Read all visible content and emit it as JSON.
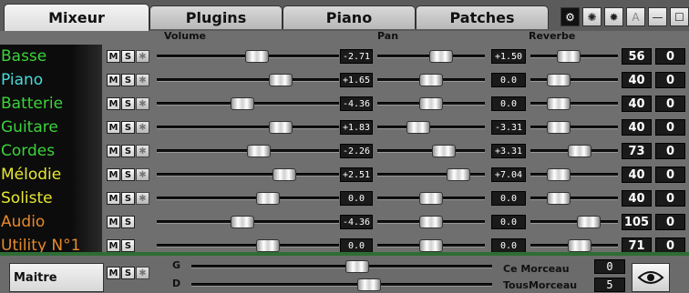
{
  "tabs": [
    {
      "label": "Mixeur",
      "active": true
    },
    {
      "label": "Plugins",
      "active": false
    },
    {
      "label": "Piano",
      "active": false
    },
    {
      "label": "Patches",
      "active": false
    }
  ],
  "toolbar": {
    "icons": [
      "gear-icon",
      "burst-icon",
      "burst-icon",
      "font-a-icon",
      "minimize-icon",
      "maximize-icon"
    ],
    "a_label": "A",
    "minus_label": "—"
  },
  "headers": {
    "volume": "Volume",
    "pan": "Pan",
    "reverb": "Reverbe"
  },
  "buttons": {
    "mute": "M",
    "solo": "S"
  },
  "tracks": [
    {
      "name": "Basse",
      "color": "#3cd23c",
      "volume": "-2.71",
      "pan": "+1.50",
      "reverb": "56",
      "extra": "0",
      "vol_pos": 0.55,
      "pan_pos": 0.59,
      "rev_pos": 0.44,
      "fx": true
    },
    {
      "name": "Piano",
      "color": "#4ad9d9",
      "volume": "+1.65",
      "pan": "0.0",
      "reverb": "40",
      "extra": "0",
      "vol_pos": 0.68,
      "pan_pos": 0.5,
      "rev_pos": 0.32,
      "fx": true
    },
    {
      "name": "Batterie",
      "color": "#3cd23c",
      "volume": "-4.36",
      "pan": "0.0",
      "reverb": "40",
      "extra": "0",
      "vol_pos": 0.47,
      "pan_pos": 0.5,
      "rev_pos": 0.32,
      "fx": true
    },
    {
      "name": "Guitare",
      "color": "#3cd23c",
      "volume": "+1.83",
      "pan": "-3.31",
      "reverb": "40",
      "extra": "0",
      "vol_pos": 0.68,
      "pan_pos": 0.38,
      "rev_pos": 0.32,
      "fx": true
    },
    {
      "name": "Cordes",
      "color": "#3cd23c",
      "volume": "-2.26",
      "pan": "+3.31",
      "reverb": "73",
      "extra": "0",
      "vol_pos": 0.56,
      "pan_pos": 0.62,
      "rev_pos": 0.56,
      "fx": true
    },
    {
      "name": "Mélodie",
      "color": "#e8e832",
      "volume": "+2.51",
      "pan": "+7.04",
      "reverb": "40",
      "extra": "0",
      "vol_pos": 0.7,
      "pan_pos": 0.75,
      "rev_pos": 0.32,
      "fx": true
    },
    {
      "name": "Soliste",
      "color": "#e8e832",
      "volume": "0.0",
      "pan": "0.0",
      "reverb": "40",
      "extra": "0",
      "vol_pos": 0.61,
      "pan_pos": 0.5,
      "rev_pos": 0.32,
      "fx": true
    },
    {
      "name": "Audio",
      "color": "#e6892c",
      "volume": "-4.36",
      "pan": "0.0",
      "reverb": "105",
      "extra": "0",
      "vol_pos": 0.47,
      "pan_pos": 0.5,
      "rev_pos": 0.67,
      "fx": false
    },
    {
      "name": "Utility N°1",
      "color": "#e6892c",
      "volume": "0.0",
      "pan": "0.0",
      "reverb": "71",
      "extra": "0",
      "vol_pos": 0.61,
      "pan_pos": 0.5,
      "rev_pos": 0.56,
      "fx": false
    }
  ],
  "master": {
    "name": "Maitre",
    "g_label": "G",
    "d_label": "D",
    "g_pos": 0.55,
    "d_pos": 0.59,
    "this_song_label": "Ce Morceau",
    "this_song_value": "0",
    "all_songs_label": "TousMorceau",
    "all_songs_value": "5"
  }
}
